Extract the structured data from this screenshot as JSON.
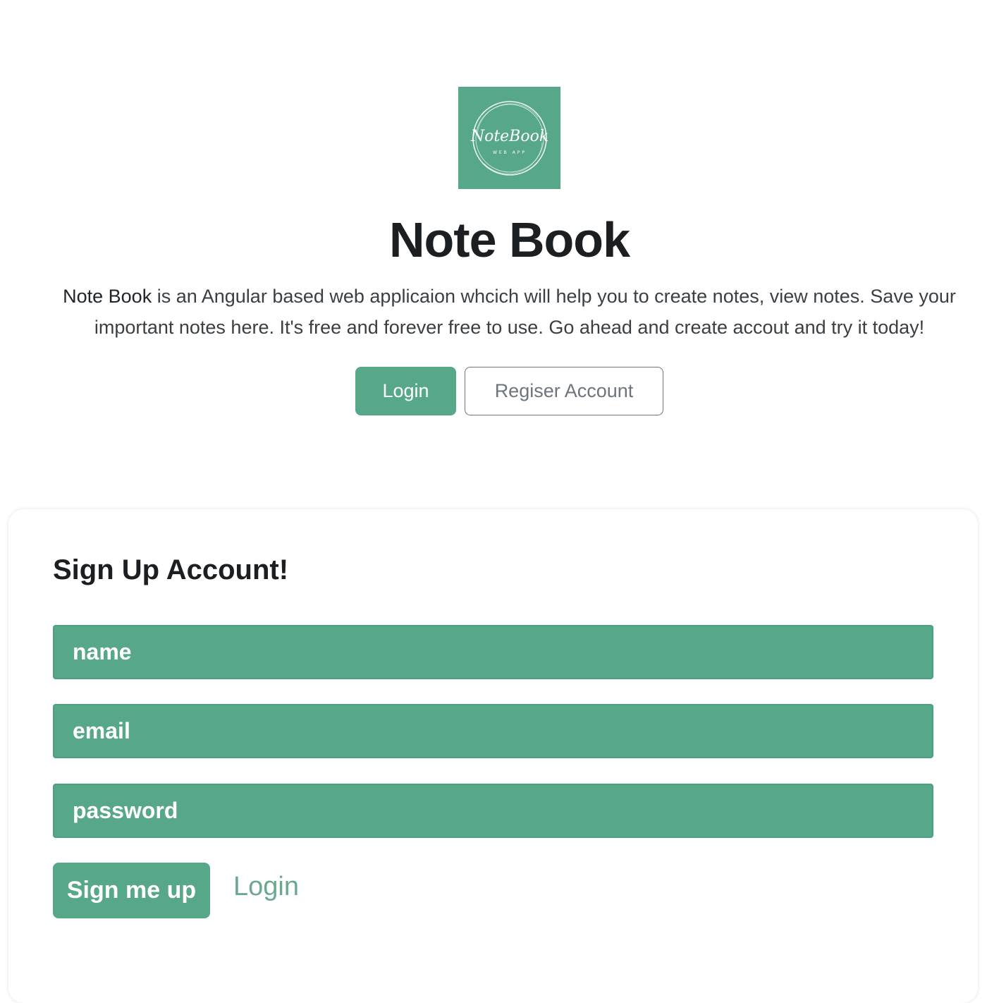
{
  "hero": {
    "logo": {
      "icon": "notebook-logo-icon",
      "text": "NoteBook",
      "subtext": "WEB APP",
      "background": "#57a789"
    },
    "title": "Note Book",
    "description_bold": "Note Book",
    "description": " is an Angular based web applicaion whcich will help you to create notes, view notes. Save your important notes here. It's free and forever free to use. Go ahead and create accout and try it today!",
    "login_label": "Login",
    "register_label": "Regiser Account"
  },
  "signup": {
    "heading": "Sign Up Account!",
    "name_placeholder": "name",
    "email_placeholder": "email",
    "password_placeholder": "password",
    "submit_label": "Sign me up",
    "login_link": "Login"
  },
  "colors": {
    "accent": "#57a789",
    "text": "#212529",
    "muted": "#6c757d"
  }
}
